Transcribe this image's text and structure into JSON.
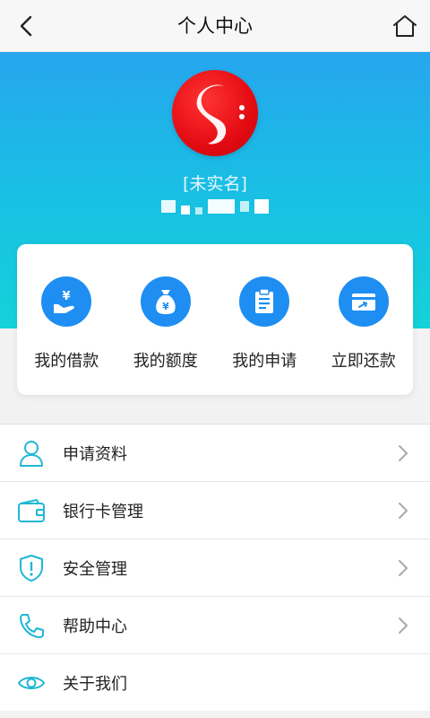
{
  "nav": {
    "title": "个人中心",
    "back_icon": "chevron-left-icon",
    "home_icon": "home-icon"
  },
  "profile": {
    "status": "[未实名]"
  },
  "quick_actions": [
    {
      "label": "我的借款",
      "icon": "hand-yen-icon"
    },
    {
      "label": "我的额度",
      "icon": "money-bag-icon"
    },
    {
      "label": "我的申请",
      "icon": "clipboard-icon"
    },
    {
      "label": "立即还款",
      "icon": "card-payment-icon"
    }
  ],
  "menu": [
    {
      "label": "申请资料",
      "icon": "user-icon"
    },
    {
      "label": "银行卡管理",
      "icon": "wallet-icon"
    },
    {
      "label": "安全管理",
      "icon": "shield-alert-icon"
    },
    {
      "label": "帮助中心",
      "icon": "phone-icon"
    },
    {
      "label": "关于我们",
      "icon": "eye-icon"
    }
  ],
  "colors": {
    "accent": "#1e8ef2",
    "icon_teal": "#1fb8d4",
    "hero_top": "#26a6ee",
    "hero_bottom": "#14d2d9",
    "logo_red": "#e30b12"
  }
}
